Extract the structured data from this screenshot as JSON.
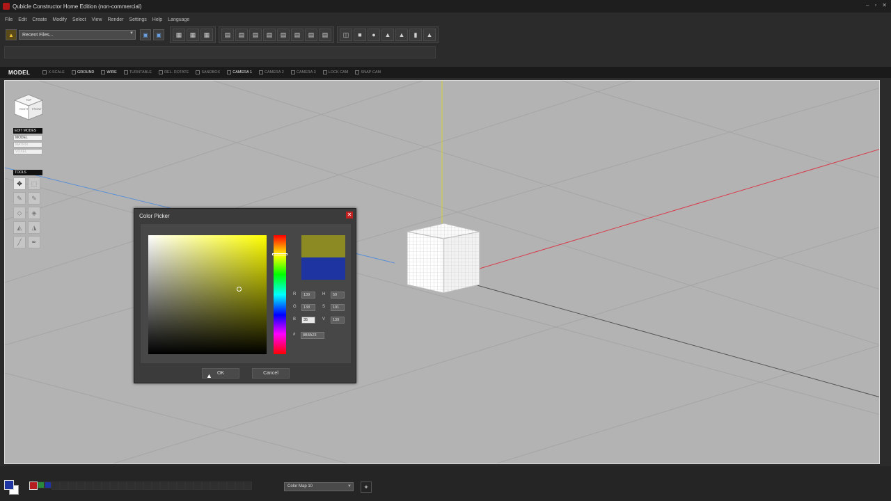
{
  "window": {
    "title": "Qubicle Constructor Home Edition (non-commercial)",
    "controls": [
      "–",
      "▫",
      "✕"
    ]
  },
  "menu": {
    "items": [
      "File",
      "Edit",
      "Create",
      "Modify",
      "Select",
      "View",
      "Render",
      "Settings",
      "Help",
      "Language"
    ]
  },
  "toolbar": {
    "recent_files": "Recent Files...",
    "export_labels": [
      "xxx",
      "hierarchy",
      "multiple"
    ],
    "format_labels": [
      "vox",
      "vxl",
      "xxxxxx",
      "xxx",
      "obj",
      "stl",
      "qef",
      "qb"
    ]
  },
  "view_strip": {
    "mode": "MODEL",
    "options": [
      {
        "label": "X-SCALE",
        "on": false
      },
      {
        "label": "GROUND",
        "on": true
      },
      {
        "label": "WIRE",
        "on": true
      },
      {
        "label": "TURNTABLE",
        "on": false
      },
      {
        "label": "REL. ROTATE",
        "on": false
      },
      {
        "label": "SANDBOX",
        "on": false
      },
      {
        "label": "CAMERA 1",
        "on": true
      },
      {
        "label": "CAMERA 2",
        "on": false
      },
      {
        "label": "CAMERA 3",
        "on": false
      },
      {
        "label": "LOCK CAM",
        "on": false
      },
      {
        "label": "SNAP CAM",
        "on": false
      }
    ]
  },
  "viewport": {
    "navcube": {
      "face_left": "RIGHT",
      "face_right": "FRONT",
      "face_top": "TOP"
    },
    "edit_modes": {
      "header": "EDIT MODES",
      "items": [
        "MODEL",
        "MATRIX",
        "VOXEL"
      ]
    },
    "tools": {
      "header": "TOOLS"
    }
  },
  "color_picker": {
    "title": "Color Picker",
    "close": "✕",
    "new_color": "#8B8A23",
    "old_color": "#1E34A0",
    "fields": {
      "R": {
        "label": "R",
        "value": "139"
      },
      "G": {
        "label": "G",
        "value": "138"
      },
      "B": {
        "label": "B",
        "value": "35"
      },
      "H": {
        "label": "H",
        "value": "59"
      },
      "S": {
        "label": "S",
        "value": "191"
      },
      "V": {
        "label": "V",
        "value": "139"
      }
    },
    "hex_label": "#",
    "hex_value": "8B8A23",
    "ok": "OK",
    "cancel": "Cancel"
  },
  "bottom_bar": {
    "primary_color": "#1E34A0",
    "palette_colors": [
      "#b51e1e",
      "#2a8a3a",
      "#1e34a0"
    ],
    "color_map": "Color Map 10"
  }
}
